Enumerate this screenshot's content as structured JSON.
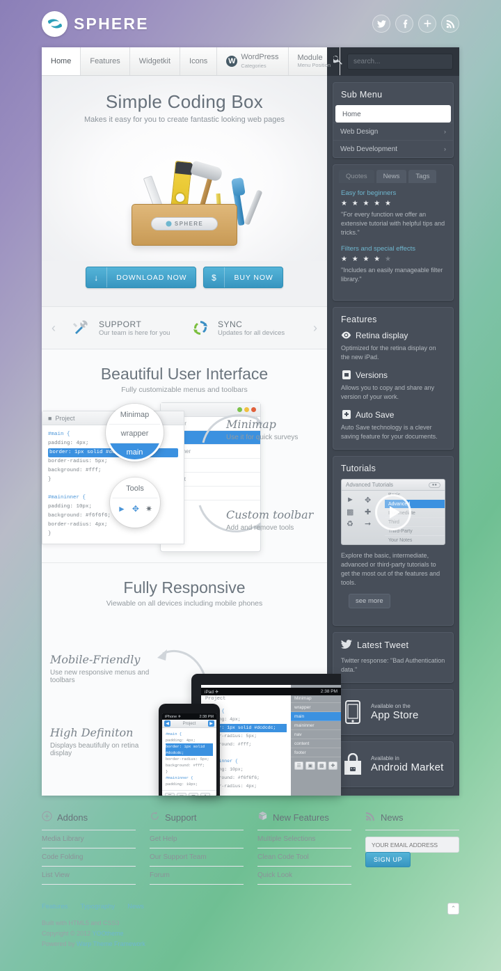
{
  "brand": {
    "name": "SPHERE"
  },
  "social": [
    {
      "name": "twitter-icon",
      "glyph": "★"
    },
    {
      "name": "facebook-icon",
      "glyph": "f"
    },
    {
      "name": "google-plus-icon",
      "glyph": "+"
    },
    {
      "name": "rss-icon",
      "glyph": "◔"
    }
  ],
  "nav": [
    {
      "label": "Home",
      "sub": "",
      "active": true
    },
    {
      "label": "Features",
      "sub": "",
      "active": false
    },
    {
      "label": "Widgetkit",
      "sub": "",
      "active": false
    },
    {
      "label": "Icons",
      "sub": "",
      "active": false
    },
    {
      "label": "WordPress",
      "sub": "Categories",
      "active": false,
      "icon": "wordpress-icon"
    },
    {
      "label": "Module",
      "sub": "Menu Position",
      "active": false
    }
  ],
  "search": {
    "placeholder": "search...",
    "value": ""
  },
  "hero": {
    "title": "Simple Coding Box",
    "subtitle": "Makes it easy for you to create fantastic looking web pages",
    "case_label": "SPHERE",
    "buttons": [
      {
        "label": "DOWNLOAD NOW",
        "icon": "download-icon",
        "glyph": "↓"
      },
      {
        "label": "BUY NOW",
        "icon": "dollar-icon",
        "glyph": "$"
      }
    ]
  },
  "feature_row": {
    "prev": "‹",
    "next": "›",
    "items": [
      {
        "title": "SUPPORT",
        "subtitle": "Our team is here for you",
        "icon": "tools-icon"
      },
      {
        "title": "SYNC",
        "subtitle": "Updates for all devices",
        "icon": "sync-icon"
      }
    ]
  },
  "section_ui": {
    "title": "Beautiful User Interface",
    "subtitle": "Fully customizable menus and toolbars",
    "editor": {
      "project_label": "Project",
      "lines": [
        "#main {",
        "   padding: 4px;",
        "   border: 1px solid #dcdcdc;",
        "   border-radius: 5px;",
        "   background: #fff;",
        "}",
        "",
        "#maininner {",
        "   padding: 10px;",
        "   background: #f6f6f6;",
        "   border-radius: 4px;",
        "}"
      ],
      "selected_line": "   border: 1px solid #dcdcdc;"
    },
    "minimap_rows": [
      "Minimap",
      "wrapper",
      "main",
      "maininner",
      "Nav",
      "Content",
      "Footer"
    ],
    "minimap_selected": "main",
    "tools_label": "Tools",
    "annotations": [
      {
        "head": "Minimap",
        "text": "Use it for quick surveys"
      },
      {
        "head": "Custom toolbar",
        "text": "Add and remove tools"
      }
    ]
  },
  "section_resp": {
    "title": "Fully Responsive",
    "subtitle": "Viewable on all devices including mobile phones",
    "blocks": [
      {
        "head": "Mobile-Friendly",
        "text": "Use new responsive menus and toolbars"
      },
      {
        "head": "High Definiton",
        "text": "Displays beautifully on retina display"
      }
    ],
    "ipad": {
      "status_left": "iPad ✈",
      "status_right": "2:38 PM",
      "project_label": "Project",
      "lines": [
        "#main {",
        "  padding: 4px;",
        "  border: 1px solid #dcdcdc;",
        "  border-radius: 5px;",
        "  background: #fff;",
        "}",
        "",
        "#maininner {",
        "  padding: 10px;",
        "  background: #f6f6f6;",
        "  border-radius: 4px;"
      ],
      "selected_line": "  border: 1px solid #dcdcdc;",
      "right_rows": [
        "Minimap",
        "wrapper",
        "main",
        "maininner",
        "nav",
        "content",
        "footer"
      ],
      "right_selected": "main"
    },
    "iphone": {
      "status_left": "iPhone ✈",
      "status_right": "2:38 PM",
      "project_label": "Project",
      "lines": [
        "#main {",
        "  padding: 4px;",
        "  border: 1px solid #dcdcdc;",
        "  border-radius: 5px;",
        "  background: #fff;",
        "}",
        "",
        "#maininner {",
        "  padding: 10px;"
      ],
      "selected_line": "  border: 1px solid #dcdcdc;"
    }
  },
  "aside": {
    "submenu": {
      "title": "Sub Menu",
      "items": [
        {
          "label": "Home",
          "active": true,
          "chevron": ""
        },
        {
          "label": "Web Design",
          "active": false,
          "chevron": "›"
        },
        {
          "label": "Web Development",
          "active": false,
          "chevron": "›"
        }
      ]
    },
    "tabs": [
      {
        "label": "Quotes",
        "active": true
      },
      {
        "label": "News",
        "active": false
      },
      {
        "label": "Tags",
        "active": false
      }
    ],
    "quotes": [
      {
        "title": "Easy for beginners",
        "stars": 5,
        "text": "\"For every function we offer an extensive tutorial with helpful tips and tricks.\""
      },
      {
        "title": "Filters and special effects",
        "stars": 4,
        "text": "\"Includes an easily manageable filter library.\""
      }
    ],
    "features": {
      "title": "Features",
      "items": [
        {
          "name": "Retina display",
          "icon": "eye-icon",
          "desc": "Optimized for the retina display on the new iPad."
        },
        {
          "name": "Versions",
          "icon": "versions-icon",
          "desc": "Allows you to copy and share any version of your work."
        },
        {
          "name": "Auto Save",
          "icon": "autosave-icon",
          "desc": "Auto Save technology is a clever saving feature for your documents."
        }
      ]
    },
    "tutorials": {
      "title": "Tutorials",
      "image_title": "Advanced Tutorials",
      "rows": [
        "Basic",
        "Advanced",
        "Intermediate",
        "Third",
        "Third-Party",
        "Your Notes"
      ],
      "selected_row": "Advanced",
      "desc": "Explore the basic, intermediate, advanced or third-party tutorials to get the most out of the features and tools.",
      "button": "see more"
    },
    "tweet": {
      "title": "Latest Tweet",
      "icon": "twitter-icon",
      "text": "Twitter response: \"Bad Authentication data.\""
    },
    "stores": [
      {
        "small": "Available on the",
        "large": "App Store",
        "icon": "iphone-icon"
      },
      {
        "small": "Available in",
        "large": "Android Market",
        "icon": "android-bag-icon"
      }
    ]
  },
  "footer": {
    "columns": [
      {
        "title": "Addons",
        "icon": "plus-circle-icon",
        "links": [
          "Media Library",
          "Code Folding",
          "List View"
        ]
      },
      {
        "title": "Support",
        "icon": "refresh-icon",
        "links": [
          "Get Help",
          "Our Support Team",
          "Forum"
        ]
      },
      {
        "title": "New Features",
        "icon": "box-icon",
        "links": [
          "Multiple Selections",
          "Clean Code Tool",
          "Quick Look"
        ]
      }
    ],
    "news": {
      "title": "News",
      "icon": "rss-icon",
      "email_placeholder": "YOUR EMAIL ADDRESS",
      "email_value": "",
      "signup": "SIGN UP"
    },
    "bottom_links": [
      "Features",
      "Typography",
      "News"
    ],
    "credits": [
      {
        "pre": "Built with HTML5 and CSS3",
        "link": "",
        "post": ""
      },
      {
        "pre": "Copyright © 2012 ",
        "link": "YOOtheme",
        "post": ""
      },
      {
        "pre": "Powered by ",
        "link": "Warp Theme Framework",
        "post": ""
      }
    ],
    "to_top": "⌃"
  }
}
